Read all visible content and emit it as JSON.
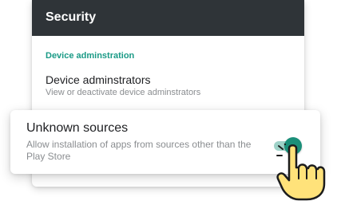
{
  "header": {
    "title": "Security"
  },
  "device_admin": {
    "section_label": "Device adminstration",
    "item_title": "Device adminstrators",
    "item_subtitle": "View or deactivate device adminstrators"
  },
  "unknown_sources": {
    "title": "Unknown sources",
    "subtitle": "Allow installation of apps from sources other than the Play Store",
    "enabled": true
  },
  "colors": {
    "header_bg": "#2f3438",
    "accent": "#1a9a86",
    "toggle_thumb": "#1a8f79",
    "toggle_track": "#9fd2c8",
    "hand_fill": "#ffe27a"
  },
  "icons": {
    "cursor": "pointing-hand-icon"
  }
}
